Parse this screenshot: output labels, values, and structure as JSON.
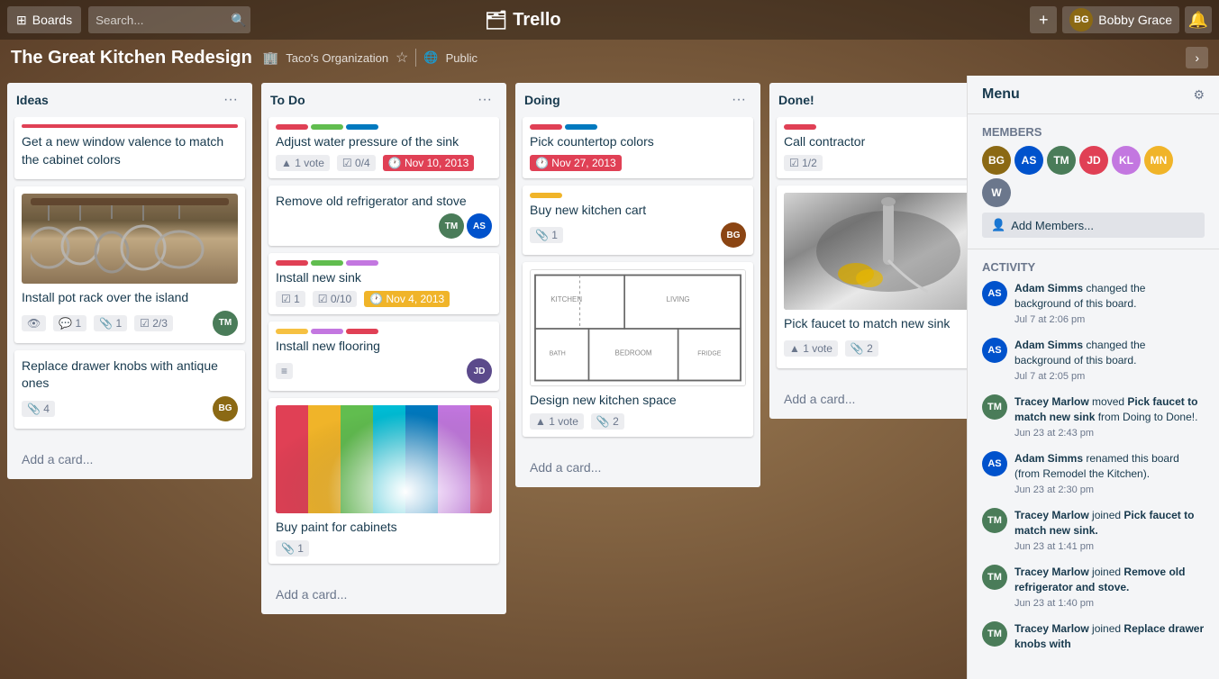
{
  "header": {
    "boards_label": "Boards",
    "search_placeholder": "Search...",
    "logo_text": "Trello",
    "add_btn": "+",
    "user_name": "Bobby Grace",
    "notification_icon": "🔔"
  },
  "board": {
    "title": "The Great Kitchen Redesign",
    "org": "Taco's Organization",
    "visibility": "Public",
    "collapse_icon": "›"
  },
  "columns": [
    {
      "id": "ideas",
      "title": "Ideas",
      "cards": [
        {
          "id": "ideas-1",
          "color": "red",
          "title": "Get a new window valence to match the cabinet colors",
          "has_image": false,
          "badges": []
        },
        {
          "id": "ideas-2",
          "title": "Install pot rack over the island",
          "color": "none",
          "has_pot_image": true,
          "badges": [
            {
              "type": "watch",
              "value": ""
            },
            {
              "type": "comment",
              "value": "1"
            },
            {
              "type": "attach",
              "value": "1"
            },
            {
              "type": "checklist",
              "value": "2/3"
            }
          ],
          "member_color": "#4a7c59"
        },
        {
          "id": "ideas-3",
          "title": "Replace drawer knobs with antique ones",
          "color": "none",
          "badges": [
            {
              "type": "attach",
              "value": "4"
            }
          ],
          "member_color": "#8b6914"
        }
      ],
      "add_label": "Add a card..."
    },
    {
      "id": "todo",
      "title": "To Do",
      "cards": [
        {
          "id": "todo-1",
          "colors": [
            "red",
            "green",
            "blue"
          ],
          "title": "Adjust water pressure of the sink",
          "badges": [
            {
              "type": "vote",
              "value": "1 vote"
            },
            {
              "type": "checklist",
              "value": "0/4"
            },
            {
              "type": "date",
              "value": "Nov 10, 2013",
              "style": "overdue"
            }
          ]
        },
        {
          "id": "todo-2",
          "title": "Remove old refrigerator and stove",
          "colors": [],
          "badges": [],
          "members": 2
        },
        {
          "id": "todo-3",
          "colors": [
            "red",
            "green",
            "purple"
          ],
          "title": "Install new sink",
          "badges": [
            {
              "type": "checklist2",
              "value": "1"
            },
            {
              "type": "checklist",
              "value": "0/10"
            },
            {
              "type": "date",
              "value": "Nov 4, 2013",
              "style": "normal"
            }
          ]
        },
        {
          "id": "todo-4",
          "colors": [
            "yellow",
            "purple",
            "red"
          ],
          "title": "Install new flooring",
          "badges": [
            {
              "type": "lines",
              "value": ""
            }
          ],
          "member_color": "#5b4a8b"
        },
        {
          "id": "todo-5",
          "title": "Buy paint for cabinets",
          "has_swatch": true,
          "colors": [],
          "badges": [
            {
              "type": "attach",
              "value": "1"
            }
          ]
        }
      ],
      "add_label": "Add a card..."
    },
    {
      "id": "doing",
      "title": "Doing",
      "cards": [
        {
          "id": "doing-1",
          "colors": [
            "red",
            "blue"
          ],
          "title": "Pick countertop colors",
          "badges": [
            {
              "type": "date",
              "value": "Nov 27, 2013",
              "style": "overdue"
            }
          ]
        },
        {
          "id": "doing-2",
          "colors": [
            "orange"
          ],
          "title": "Buy new kitchen cart",
          "badges": [
            {
              "type": "attach",
              "value": "1"
            }
          ],
          "member_color": "#8b4513"
        },
        {
          "id": "doing-3",
          "title": "Design new kitchen space",
          "has_floor": true,
          "colors": [],
          "badges": [
            {
              "type": "vote",
              "value": "1 vote"
            },
            {
              "type": "attach",
              "value": "2"
            }
          ]
        }
      ],
      "add_label": "Add a card..."
    },
    {
      "id": "done",
      "title": "Done!",
      "cards": [
        {
          "id": "done-1",
          "colors": [
            "red"
          ],
          "title": "Call contractor",
          "badges": [
            {
              "type": "checklist",
              "value": "1/2"
            }
          ]
        },
        {
          "id": "done-2",
          "title": "Pick faucet to match new sink",
          "has_sink": true,
          "colors": [],
          "badges": [
            {
              "type": "vote",
              "value": "1 vote"
            },
            {
              "type": "attach",
              "value": "2"
            }
          ],
          "member_color": "#4a7c59"
        }
      ],
      "add_label": "Add a card..."
    }
  ],
  "panel": {
    "title": "Menu",
    "members_title": "Members",
    "add_members_label": "Add Members...",
    "activity_title": "Activity",
    "activities": [
      {
        "user": "Adam Simms",
        "color": "#0052cc",
        "initials": "AS",
        "text": "changed the background of this board.",
        "time": "Jul 7 at 2:06 pm"
      },
      {
        "user": "Adam Simms",
        "color": "#0052cc",
        "initials": "AS",
        "text": "changed the background of this board.",
        "time": "Jul 7 at 2:05 pm"
      },
      {
        "user": "Tracey Marlow",
        "color": "#4a7c59",
        "initials": "TM",
        "text": "moved Pick faucet to match new sink from Doing to Done!.",
        "time": "Jun 23 at 2:43 pm"
      },
      {
        "user": "Adam Simms",
        "color": "#0052cc",
        "initials": "AS",
        "text": "renamed this board (from Remodel the Kitchen).",
        "time": "Jun 23 at 2:30 pm"
      },
      {
        "user": "Tracey Marlow",
        "color": "#4a7c59",
        "initials": "TM",
        "text": "joined Pick faucet to match new sink.",
        "time": "Jun 23 at 1:41 pm"
      },
      {
        "user": "Tracey Marlow",
        "color": "#4a7c59",
        "initials": "TM",
        "text": "joined Remove old refrigerator and stove.",
        "time": "Jun 23 at 1:40 pm"
      },
      {
        "user": "Tracey Marlow",
        "color": "#4a7c59",
        "initials": "TM",
        "text": "joined Replace drawer knobs with",
        "time": ""
      }
    ],
    "members": [
      {
        "initials": "BG",
        "color": "#8b6914"
      },
      {
        "initials": "AS",
        "color": "#0052cc"
      },
      {
        "initials": "TM",
        "color": "#4a7c59"
      },
      {
        "initials": "JD",
        "color": "#e04055"
      },
      {
        "initials": "KL",
        "color": "#c377e0"
      },
      {
        "initials": "MN",
        "color": "#f0b429"
      },
      {
        "initials": "W",
        "color": "#6b778c"
      }
    ]
  }
}
